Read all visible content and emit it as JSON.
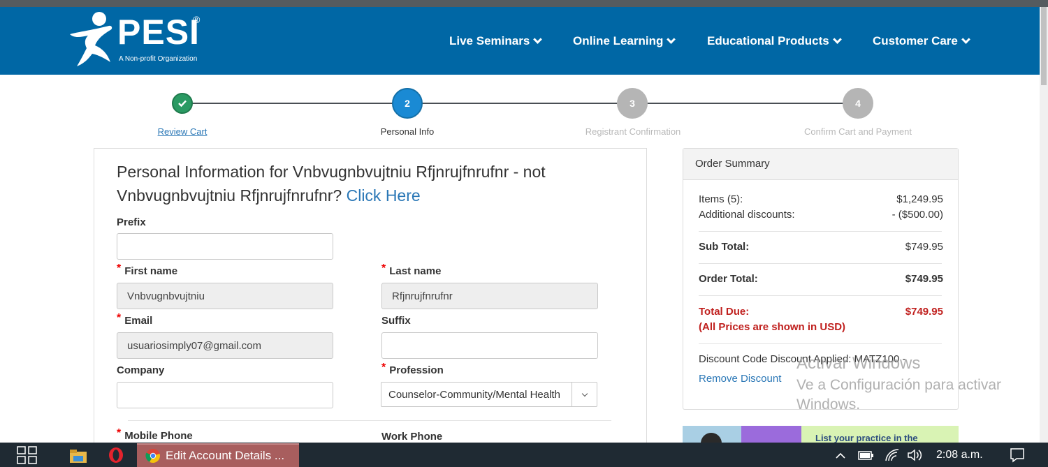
{
  "brand": {
    "name": "PESI",
    "registered": "®",
    "tagline": "A Non-profit Organization"
  },
  "nav": {
    "items": [
      {
        "label": "Live Seminars"
      },
      {
        "label": "Online Learning"
      },
      {
        "label": "Educational Products"
      },
      {
        "label": "Customer Care"
      }
    ]
  },
  "steps": [
    {
      "number": "",
      "label": "Review Cart",
      "state": "done"
    },
    {
      "number": "2",
      "label": "Personal Info",
      "state": "active"
    },
    {
      "number": "3",
      "label": "Registrant Confirmation",
      "state": "pending"
    },
    {
      "number": "4",
      "label": "Confirm Cart and Payment",
      "state": "pending"
    }
  ],
  "personal": {
    "title_prefix": "Personal Information for Vnbvugnbvujtniu Rfjnrujfnrufnr - not Vnbvugnbvujtniu Rfjnrujfnrufnr?",
    "click_here": "Click Here",
    "required_mark": "*",
    "fields": {
      "prefix": {
        "label": "Prefix",
        "value": ""
      },
      "first_name": {
        "label": "First name",
        "value": "Vnbvugnbvujtniu"
      },
      "last_name": {
        "label": "Last name",
        "value": "Rfjnrujfnrufnr"
      },
      "email": {
        "label": "Email",
        "value": "usuariosimply07@gmail.com"
      },
      "suffix": {
        "label": "Suffix",
        "value": ""
      },
      "company": {
        "label": "Company",
        "value": ""
      },
      "profession": {
        "label": "Profession",
        "value": "Counselor-Community/Mental Health"
      },
      "mobile_phone": {
        "label": "Mobile Phone"
      },
      "work_phone": {
        "label": "Work Phone"
      }
    }
  },
  "summary": {
    "title": "Order Summary",
    "items_label": "Items (5):",
    "items_value": "$1,249.95",
    "discounts_label": "Additional discounts:",
    "discounts_value": "- ($500.00)",
    "subtotal_label": "Sub Total:",
    "subtotal_value": "$749.95",
    "order_total_label": "Order Total:",
    "order_total_value": "$749.95",
    "total_due_label": "Total Due:",
    "total_due_value": "$749.95",
    "usd_note": "(All Prices are shown in USD)",
    "discount_code_text": "Discount Code Discount Applied: MATZ100 -",
    "remove_discount": "Remove Discount"
  },
  "watermark": {
    "line1": "Activar Windows",
    "line2": "Ve a Configuración para activar",
    "line3": "Windows."
  },
  "promo": {
    "text": "List your practice in the"
  },
  "taskbar": {
    "app_label": "Edit Account Details ...",
    "time": "2:08 a.m."
  },
  "colors": {
    "header": "#0067a5",
    "done": "#2a9a63",
    "active": "#1a8ad4",
    "pending": "#b5b5b5",
    "link": "#2a77b6",
    "red": "#c0201e"
  }
}
